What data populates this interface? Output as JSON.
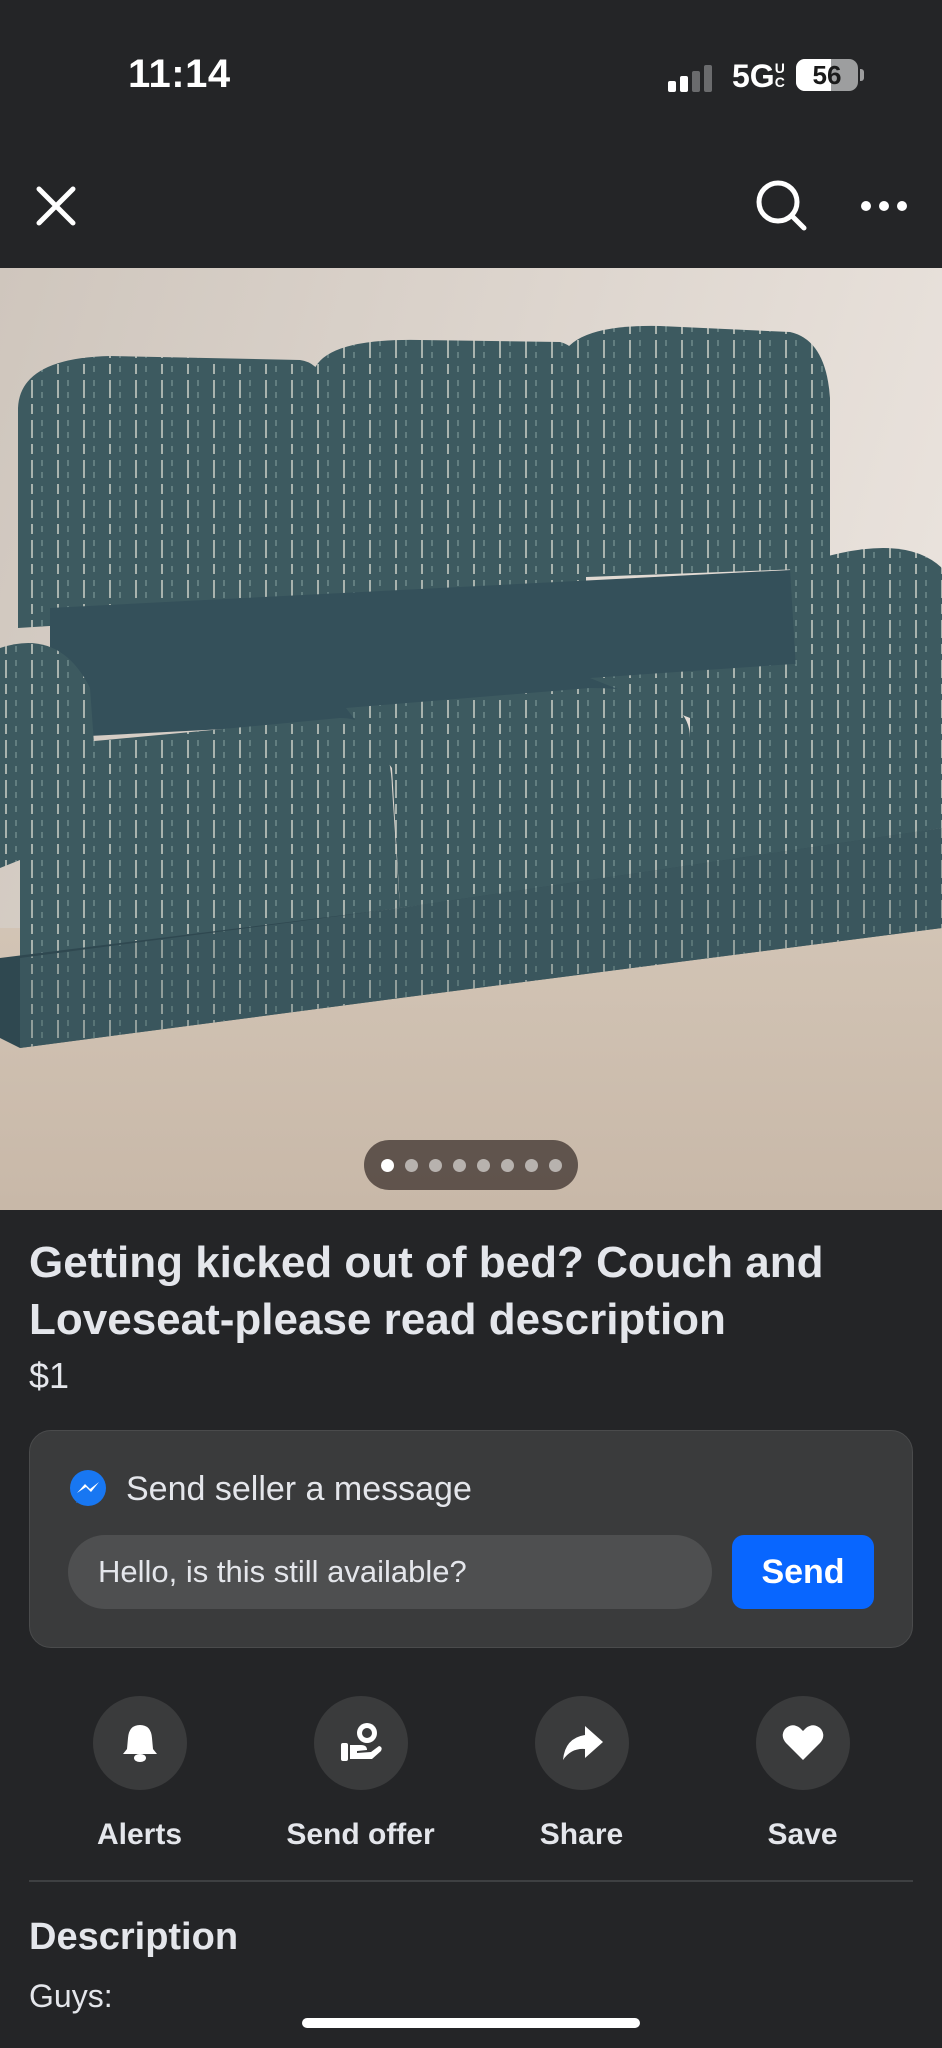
{
  "status_bar": {
    "time": "11:14",
    "network": "5G",
    "network_suffix": "UC",
    "battery": "56"
  },
  "nav": {
    "close_icon": "close-icon",
    "search_icon": "search-icon",
    "more_icon": "more-icon"
  },
  "photo": {
    "page_count": 8,
    "current_page": 1
  },
  "listing": {
    "title": "Getting kicked out of bed?  Couch and Loveseat-please read description",
    "price": "$1"
  },
  "message": {
    "heading": "Send seller a message",
    "input_value": "Hello, is this still available?",
    "send_label": "Send"
  },
  "actions": [
    {
      "label": "Alerts",
      "icon": "bell-icon"
    },
    {
      "label": "Send offer",
      "icon": "offer-icon"
    },
    {
      "label": "Share",
      "icon": "share-icon"
    },
    {
      "label": "Save",
      "icon": "heart-icon"
    }
  ],
  "description": {
    "heading": "Description",
    "body": "Guys:"
  },
  "colors": {
    "background": "#242527",
    "card": "#3a3b3c",
    "accent": "#0866ff",
    "text": "#e4e6eb"
  }
}
